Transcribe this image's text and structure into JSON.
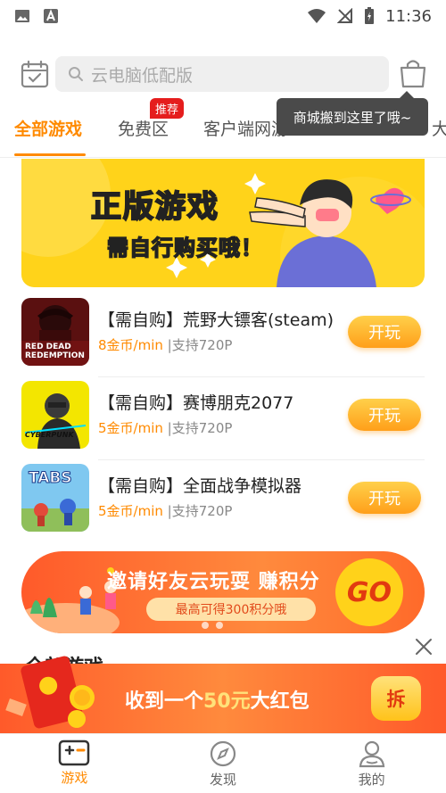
{
  "status_bar": {
    "time": "11:36",
    "icons_left": [
      "image-icon",
      "app-notification-icon"
    ],
    "icons_right": [
      "wifi-icon",
      "no-signal-icon",
      "battery-charging-icon"
    ]
  },
  "header": {
    "search_placeholder": "云电脑低配版",
    "left_icon": "calendar-check-icon",
    "right_icon": "shopping-bag-icon"
  },
  "tabs": [
    {
      "label": "全部游戏",
      "active": true
    },
    {
      "label": "免费区",
      "badge": "推荐"
    },
    {
      "label": "客户端网游"
    },
    {
      "label": "大"
    }
  ],
  "tooltip": "商城搬到这里了哦~",
  "banner": {
    "line1": "正版游戏",
    "line2": "需自行购买哦！"
  },
  "games": [
    {
      "title": "【需自购】荒野大镖客(steam)",
      "coin": "8金币/min",
      "support": "|支持720P",
      "button": "开玩",
      "thumb_text": "RED DEAD REDEMPTION"
    },
    {
      "title": "【需自购】赛博朋克2077",
      "coin": "5金币/min",
      "support": "|支持720P",
      "button": "开玩",
      "thumb_text": "CYBERPUNK"
    },
    {
      "title": "【需自购】全面战争模拟器",
      "coin": "5金币/min",
      "support": "|支持720P",
      "button": "开玩",
      "thumb_text": "TABS"
    }
  ],
  "invite": {
    "title": "邀请好友云玩耍 赚积分",
    "subtitle": "最高可得300积分哦",
    "go": "GO"
  },
  "section_heading": "全部游戏",
  "envelope": {
    "prefix": "收到一个",
    "amount": "50元",
    "suffix": "大红包",
    "open_label": "拆"
  },
  "bottom_nav": [
    {
      "label": "游戏",
      "icon": "game-controller-icon",
      "active": true
    },
    {
      "label": "发现",
      "icon": "compass-icon"
    },
    {
      "label": "我的",
      "icon": "profile-icon"
    }
  ],
  "colors": {
    "accent": "#ff8a00",
    "badge": "#e51d1d",
    "banner": "#ffd31a"
  }
}
